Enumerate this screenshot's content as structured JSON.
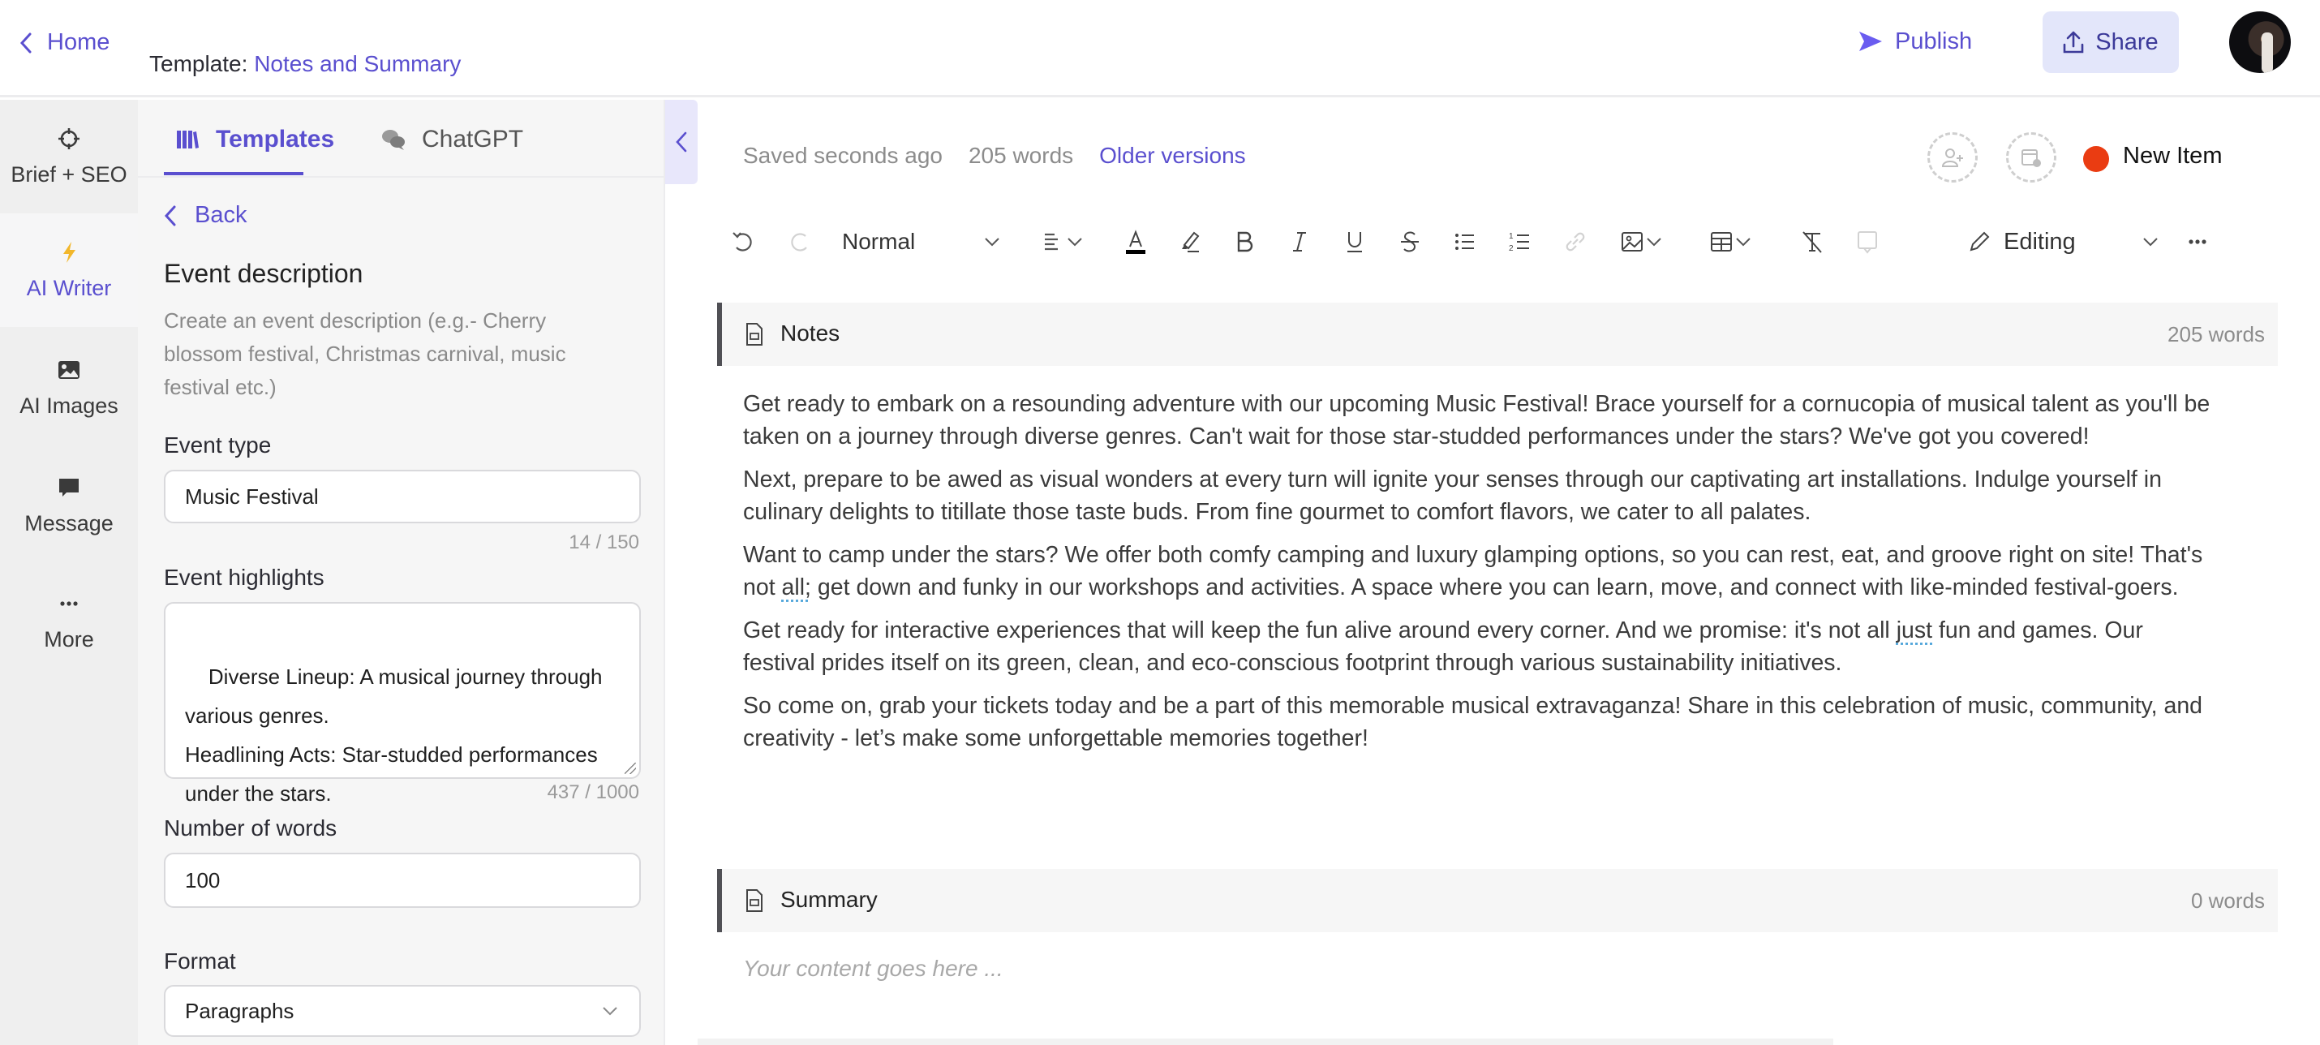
{
  "header": {
    "home_label": "Home",
    "template_prefix": "Template:",
    "template_name": "Notes and Summary",
    "publish_label": "Publish",
    "share_label": "Share",
    "avatar_icon": "user-avatar-photo"
  },
  "rail": {
    "items": [
      {
        "label": "Brief + SEO",
        "icon": "crosshair-icon",
        "active": false
      },
      {
        "label": "AI Writer",
        "icon": "lightning-icon",
        "active": true
      },
      {
        "label": "AI Images",
        "icon": "image-icon",
        "active": false
      },
      {
        "label": "Message",
        "icon": "chat-bubble-icon",
        "active": false
      },
      {
        "label": "More",
        "icon": "ellipsis-icon",
        "active": false
      }
    ]
  },
  "panel": {
    "tabs": [
      {
        "label": "Templates",
        "icon": "books-icon",
        "active": true
      },
      {
        "label": "ChatGPT",
        "icon": "chat-bubbles-icon",
        "active": false
      }
    ],
    "back_label": "Back",
    "form_title": "Event description",
    "form_description": "Create an event description (e.g.- Cherry blossom festival, Christmas carnival, music festival etc.)",
    "fields": {
      "event_type": {
        "label": "Event type",
        "value": "Music Festival",
        "count": "14 / 150"
      },
      "event_highlights": {
        "label": "Event highlights",
        "value": "Diverse Lineup: A musical journey through various genres.\nHeadlining Acts: Star-studded performances under the stars.",
        "count": "437 / 1000"
      },
      "number_of_words": {
        "label": "Number of words",
        "value": "100"
      },
      "format": {
        "label": "Format",
        "value": "Paragraphs"
      }
    }
  },
  "editor": {
    "saved_status": "Saved seconds ago",
    "word_count": "205 words",
    "older_versions_label": "Older versions",
    "status": {
      "label": "New Item",
      "color": "#ea3c12"
    },
    "toolbar": {
      "style_value": "Normal",
      "mode_label": "Editing"
    },
    "sections": {
      "notes": {
        "title": "Notes",
        "count": "205 words",
        "paragraphs": [
          "Get ready to embark on a resounding adventure with our upcoming Music Festival! Brace yourself for a cornucopia of musical talent as you'll be taken on a journey through diverse genres. Can't wait for those star-studded performances under the stars? We've got you covered!",
          "Next, prepare to be awed as visual wonders at every turn will ignite your senses through our captivating art installations. Indulge yourself in culinary delights to titillate those taste buds. From fine gourmet to comfort flavors, we cater to all palates.",
          {
            "before": "Want to camp under the stars? We offer both comfy camping and luxury glamping options, so you can rest, eat, and groove right on site! That's not ",
            "flagged": "all;",
            "after": " get down and funky in our workshops and activities. A space where you can learn, move, and connect with like-minded festival-goers."
          },
          {
            "before": "Get ready for interactive experiences that will keep the fun alive around every corner. And we promise: it's not all ",
            "flagged": "just",
            "after": " fun and games. Our festival prides itself on its green, clean, and eco-conscious footprint through various sustainability initiatives."
          },
          "So come on, grab your tickets today and be a part of this memorable musical extravaganza! Share in this celebration of music, community, and creativity - let’s make some unforgettable memories together!"
        ]
      },
      "summary": {
        "title": "Summary",
        "count": "0 words",
        "placeholder": "Your content goes here ..."
      }
    }
  },
  "colors": {
    "accent": "#5a4fcf",
    "share_bg": "#e3e6fa",
    "status_red": "#ea3c12"
  }
}
